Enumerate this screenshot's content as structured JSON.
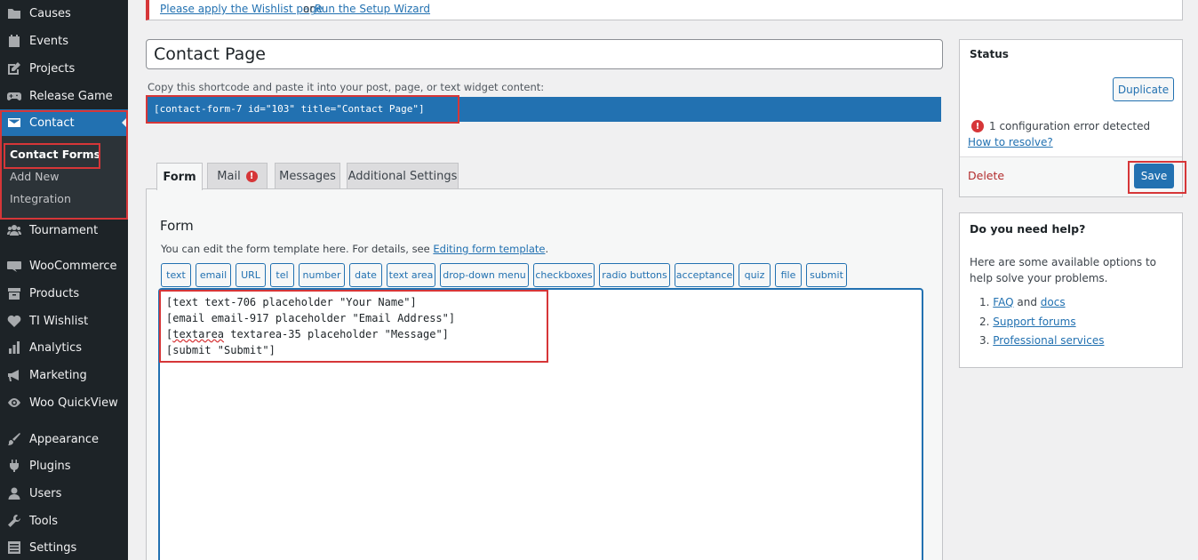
{
  "sidebar": {
    "items": [
      {
        "label": "Causes",
        "icon": "folder-icon"
      },
      {
        "label": "Events",
        "icon": "calendar-icon"
      },
      {
        "label": "Projects",
        "icon": "edit-icon"
      },
      {
        "label": "Release Game",
        "icon": "gamepad-icon"
      },
      {
        "label": "Contact",
        "icon": "mail-icon"
      },
      {
        "label": "Tournament",
        "icon": "group-icon"
      },
      {
        "label": "WooCommerce",
        "icon": "woo-icon"
      },
      {
        "label": "Products",
        "icon": "archive-icon"
      },
      {
        "label": "TI Wishlist",
        "icon": "heart-icon"
      },
      {
        "label": "Analytics",
        "icon": "bar-chart-icon"
      },
      {
        "label": "Marketing",
        "icon": "megaphone-icon"
      },
      {
        "label": "Woo QuickView",
        "icon": "eye-icon"
      },
      {
        "label": "Appearance",
        "icon": "paintbrush-icon"
      },
      {
        "label": "Plugins",
        "icon": "plug-icon"
      },
      {
        "label": "Users",
        "icon": "user-icon"
      },
      {
        "label": "Tools",
        "icon": "wrench-icon"
      },
      {
        "label": "Settings",
        "icon": "settings-icon"
      }
    ],
    "submenu": [
      "Contact Forms",
      "Add New",
      "Integration"
    ]
  },
  "notice": {
    "link1": "Please apply the Wishlist page",
    "or": "or",
    "link2": "Run the Setup Wizard"
  },
  "title": "Contact Page",
  "shortcode": {
    "label": "Copy this shortcode and paste it into your post, page, or text widget content:",
    "code": "[contact-form-7 id=\"103\" title=\"Contact Page\"]"
  },
  "tabs": [
    "Form",
    "Mail",
    "Messages",
    "Additional Settings"
  ],
  "mail_error": "!",
  "form": {
    "heading": "Form",
    "desc": "You can edit the form template here. For details, see",
    "desc_link": "Editing form template",
    "desc_end": ".",
    "tag_buttons": [
      "text",
      "email",
      "URL",
      "tel",
      "number",
      "date",
      "text area",
      "drop-down menu",
      "checkboxes",
      "radio buttons",
      "acceptance",
      "quiz",
      "file",
      "submit"
    ],
    "code_lines": [
      "[text text-706 placeholder \"Your Name\"]",
      "[email email-917 placeholder \"Email Address\"]",
      " textarea-35 placeholder \"Message\"]",
      "[submit \"Submit\"]"
    ],
    "code_line3_prefix": "[",
    "code_line3_word": "textarea"
  },
  "status": {
    "title": "Status",
    "duplicate": "Duplicate",
    "error_icon": "!",
    "error": "1 configuration error detected",
    "resolve": "How to resolve?",
    "delete": "Delete",
    "save": "Save"
  },
  "help": {
    "title": "Do you need help?",
    "text": "Here are some available options to help solve your problems.",
    "n1": "1.",
    "faq": "FAQ",
    "and": "and",
    "docs": "docs",
    "n2": "2.",
    "forums": "Support forums",
    "n3": "3.",
    "services": "Professional services"
  }
}
